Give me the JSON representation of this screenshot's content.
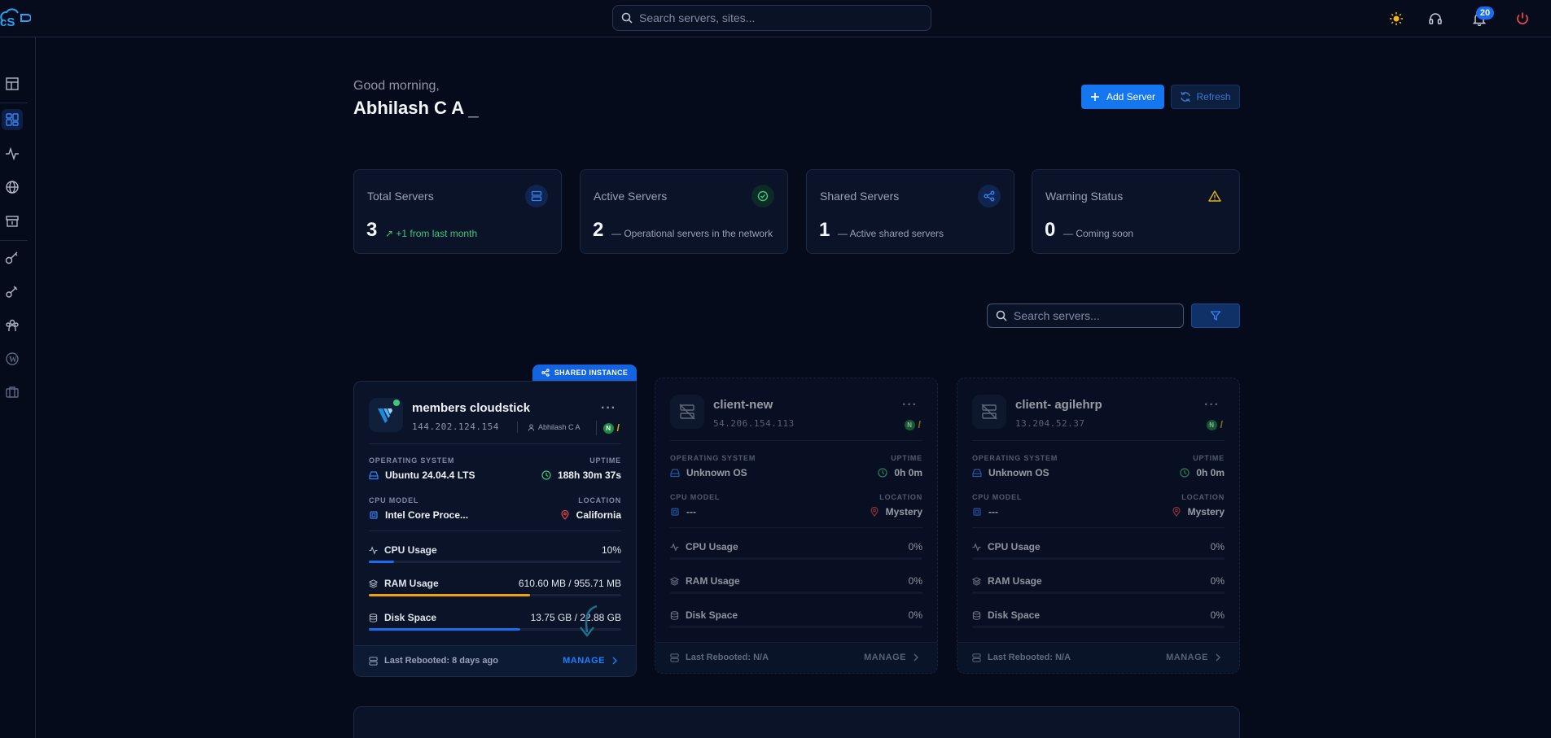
{
  "header": {
    "search_placeholder": "Search servers, sites...",
    "notification_count": "20"
  },
  "sidebar": {
    "items": [
      {
        "icon": "dashboard-layout-icon"
      },
      {
        "icon": "grid-icon",
        "active": true
      },
      {
        "icon": "activity-icon"
      },
      {
        "icon": "globe-icon"
      },
      {
        "icon": "archive-icon"
      },
      {
        "icon": "key-icon"
      },
      {
        "icon": "plug-key-icon"
      },
      {
        "icon": "team-icon"
      },
      {
        "icon": "wordpress-icon"
      },
      {
        "icon": "briefcase-icon"
      }
    ]
  },
  "greeting": {
    "subtitle": "Good morning,",
    "name": "Abhilash C A",
    "cursor": "_"
  },
  "actions": {
    "add_server": "Add Server",
    "refresh": "Refresh"
  },
  "stats": [
    {
      "label": "Total Servers",
      "value": "3",
      "note": "+1 from last month",
      "note_prefix": "↗",
      "icon": "server-icon",
      "color": "#3b82f6"
    },
    {
      "label": "Active Servers",
      "value": "2",
      "note": "Operational servers in the network",
      "note_prefix": "—",
      "icon": "check-circle-icon",
      "color": "#3fc77a"
    },
    {
      "label": "Shared Servers",
      "value": "1",
      "note": "Active shared servers",
      "note_prefix": "—",
      "icon": "share-icon",
      "color": "#3b82f6"
    },
    {
      "label": "Warning Status",
      "value": "0",
      "note": "Coming soon",
      "note_prefix": "—",
      "icon": "warning-icon",
      "color": "#e0b41b"
    }
  ],
  "server_search": {
    "placeholder": "Search servers..."
  },
  "servers": [
    {
      "shared_tag": "SHARED INSTANCE",
      "name": "members cloudstick",
      "ip": "144.202.124.154",
      "owner": "Abhilash C A",
      "os_caption": "OPERATING SYSTEM",
      "os": "Ubuntu 24.04.4 LTS",
      "uptime_caption": "UPTIME",
      "uptime": "188h 30m 37s",
      "cpu_caption": "CPU MODEL",
      "cpu_model": "Intel Core Proce...",
      "location_caption": "LOCATION",
      "location": "California",
      "cpu_label": "CPU Usage",
      "cpu_usage": "10%",
      "cpu_pct": 10,
      "ram_label": "RAM Usage",
      "ram_usage": "610.60 MB / 955.71 MB",
      "ram_pct": 64,
      "disk_label": "Disk Space",
      "disk_usage": "13.75 GB / 22.88 GB",
      "disk_pct": 60,
      "last_rebooted": "Last Rebooted: 8 days ago",
      "manage": "MANAGE"
    },
    {
      "name": "client-new",
      "ip": "54.206.154.113",
      "os_caption": "OPERATING SYSTEM",
      "os": "Unknown OS",
      "uptime_caption": "UPTIME",
      "uptime": "0h 0m",
      "cpu_caption": "CPU MODEL",
      "cpu_model": "---",
      "location_caption": "LOCATION",
      "location": "Mystery",
      "cpu_label": "CPU Usage",
      "cpu_usage": "0%",
      "ram_label": "RAM Usage",
      "ram_usage": "0%",
      "disk_label": "Disk Space",
      "disk_usage": "0%",
      "last_rebooted": "Last Rebooted: N/A",
      "manage": "MANAGE"
    },
    {
      "name": "client- agilehrp",
      "ip": "13.204.52.37",
      "os_caption": "OPERATING SYSTEM",
      "os": "Unknown OS",
      "uptime_caption": "UPTIME",
      "uptime": "0h 0m",
      "cpu_caption": "CPU MODEL",
      "cpu_model": "---",
      "location_caption": "LOCATION",
      "location": "Mystery",
      "cpu_label": "CPU Usage",
      "cpu_usage": "0%",
      "ram_label": "RAM Usage",
      "ram_usage": "0%",
      "disk_label": "Disk Space",
      "disk_usage": "0%",
      "last_rebooted": "Last Rebooted: N/A",
      "manage": "MANAGE"
    }
  ],
  "colors": {
    "accent": "#1477f0",
    "cpu_bar": "#1a6cf0",
    "ram_bar": "#f0a30a",
    "disk_bar": "#1a6cf0"
  }
}
